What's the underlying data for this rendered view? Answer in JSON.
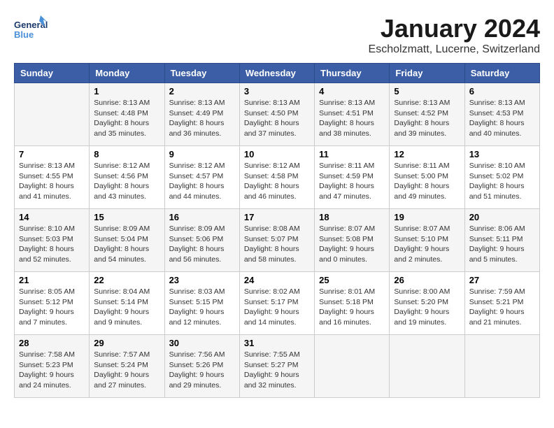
{
  "header": {
    "logo_general": "General",
    "logo_blue": "Blue",
    "month": "January 2024",
    "location": "Escholzmatt, Lucerne, Switzerland"
  },
  "weekdays": [
    "Sunday",
    "Monday",
    "Tuesday",
    "Wednesday",
    "Thursday",
    "Friday",
    "Saturday"
  ],
  "weeks": [
    [
      {
        "day": "",
        "sunrise": "",
        "sunset": "",
        "daylight": ""
      },
      {
        "day": "1",
        "sunrise": "Sunrise: 8:13 AM",
        "sunset": "Sunset: 4:48 PM",
        "daylight": "Daylight: 8 hours and 35 minutes."
      },
      {
        "day": "2",
        "sunrise": "Sunrise: 8:13 AM",
        "sunset": "Sunset: 4:49 PM",
        "daylight": "Daylight: 8 hours and 36 minutes."
      },
      {
        "day": "3",
        "sunrise": "Sunrise: 8:13 AM",
        "sunset": "Sunset: 4:50 PM",
        "daylight": "Daylight: 8 hours and 37 minutes."
      },
      {
        "day": "4",
        "sunrise": "Sunrise: 8:13 AM",
        "sunset": "Sunset: 4:51 PM",
        "daylight": "Daylight: 8 hours and 38 minutes."
      },
      {
        "day": "5",
        "sunrise": "Sunrise: 8:13 AM",
        "sunset": "Sunset: 4:52 PM",
        "daylight": "Daylight: 8 hours and 39 minutes."
      },
      {
        "day": "6",
        "sunrise": "Sunrise: 8:13 AM",
        "sunset": "Sunset: 4:53 PM",
        "daylight": "Daylight: 8 hours and 40 minutes."
      }
    ],
    [
      {
        "day": "7",
        "sunrise": "Sunrise: 8:13 AM",
        "sunset": "Sunset: 4:55 PM",
        "daylight": "Daylight: 8 hours and 41 minutes."
      },
      {
        "day": "8",
        "sunrise": "Sunrise: 8:12 AM",
        "sunset": "Sunset: 4:56 PM",
        "daylight": "Daylight: 8 hours and 43 minutes."
      },
      {
        "day": "9",
        "sunrise": "Sunrise: 8:12 AM",
        "sunset": "Sunset: 4:57 PM",
        "daylight": "Daylight: 8 hours and 44 minutes."
      },
      {
        "day": "10",
        "sunrise": "Sunrise: 8:12 AM",
        "sunset": "Sunset: 4:58 PM",
        "daylight": "Daylight: 8 hours and 46 minutes."
      },
      {
        "day": "11",
        "sunrise": "Sunrise: 8:11 AM",
        "sunset": "Sunset: 4:59 PM",
        "daylight": "Daylight: 8 hours and 47 minutes."
      },
      {
        "day": "12",
        "sunrise": "Sunrise: 8:11 AM",
        "sunset": "Sunset: 5:00 PM",
        "daylight": "Daylight: 8 hours and 49 minutes."
      },
      {
        "day": "13",
        "sunrise": "Sunrise: 8:10 AM",
        "sunset": "Sunset: 5:02 PM",
        "daylight": "Daylight: 8 hours and 51 minutes."
      }
    ],
    [
      {
        "day": "14",
        "sunrise": "Sunrise: 8:10 AM",
        "sunset": "Sunset: 5:03 PM",
        "daylight": "Daylight: 8 hours and 52 minutes."
      },
      {
        "day": "15",
        "sunrise": "Sunrise: 8:09 AM",
        "sunset": "Sunset: 5:04 PM",
        "daylight": "Daylight: 8 hours and 54 minutes."
      },
      {
        "day": "16",
        "sunrise": "Sunrise: 8:09 AM",
        "sunset": "Sunset: 5:06 PM",
        "daylight": "Daylight: 8 hours and 56 minutes."
      },
      {
        "day": "17",
        "sunrise": "Sunrise: 8:08 AM",
        "sunset": "Sunset: 5:07 PM",
        "daylight": "Daylight: 8 hours and 58 minutes."
      },
      {
        "day": "18",
        "sunrise": "Sunrise: 8:07 AM",
        "sunset": "Sunset: 5:08 PM",
        "daylight": "Daylight: 9 hours and 0 minutes."
      },
      {
        "day": "19",
        "sunrise": "Sunrise: 8:07 AM",
        "sunset": "Sunset: 5:10 PM",
        "daylight": "Daylight: 9 hours and 2 minutes."
      },
      {
        "day": "20",
        "sunrise": "Sunrise: 8:06 AM",
        "sunset": "Sunset: 5:11 PM",
        "daylight": "Daylight: 9 hours and 5 minutes."
      }
    ],
    [
      {
        "day": "21",
        "sunrise": "Sunrise: 8:05 AM",
        "sunset": "Sunset: 5:12 PM",
        "daylight": "Daylight: 9 hours and 7 minutes."
      },
      {
        "day": "22",
        "sunrise": "Sunrise: 8:04 AM",
        "sunset": "Sunset: 5:14 PM",
        "daylight": "Daylight: 9 hours and 9 minutes."
      },
      {
        "day": "23",
        "sunrise": "Sunrise: 8:03 AM",
        "sunset": "Sunset: 5:15 PM",
        "daylight": "Daylight: 9 hours and 12 minutes."
      },
      {
        "day": "24",
        "sunrise": "Sunrise: 8:02 AM",
        "sunset": "Sunset: 5:17 PM",
        "daylight": "Daylight: 9 hours and 14 minutes."
      },
      {
        "day": "25",
        "sunrise": "Sunrise: 8:01 AM",
        "sunset": "Sunset: 5:18 PM",
        "daylight": "Daylight: 9 hours and 16 minutes."
      },
      {
        "day": "26",
        "sunrise": "Sunrise: 8:00 AM",
        "sunset": "Sunset: 5:20 PM",
        "daylight": "Daylight: 9 hours and 19 minutes."
      },
      {
        "day": "27",
        "sunrise": "Sunrise: 7:59 AM",
        "sunset": "Sunset: 5:21 PM",
        "daylight": "Daylight: 9 hours and 21 minutes."
      }
    ],
    [
      {
        "day": "28",
        "sunrise": "Sunrise: 7:58 AM",
        "sunset": "Sunset: 5:23 PM",
        "daylight": "Daylight: 9 hours and 24 minutes."
      },
      {
        "day": "29",
        "sunrise": "Sunrise: 7:57 AM",
        "sunset": "Sunset: 5:24 PM",
        "daylight": "Daylight: 9 hours and 27 minutes."
      },
      {
        "day": "30",
        "sunrise": "Sunrise: 7:56 AM",
        "sunset": "Sunset: 5:26 PM",
        "daylight": "Daylight: 9 hours and 29 minutes."
      },
      {
        "day": "31",
        "sunrise": "Sunrise: 7:55 AM",
        "sunset": "Sunset: 5:27 PM",
        "daylight": "Daylight: 9 hours and 32 minutes."
      },
      {
        "day": "",
        "sunrise": "",
        "sunset": "",
        "daylight": ""
      },
      {
        "day": "",
        "sunrise": "",
        "sunset": "",
        "daylight": ""
      },
      {
        "day": "",
        "sunrise": "",
        "sunset": "",
        "daylight": ""
      }
    ]
  ]
}
